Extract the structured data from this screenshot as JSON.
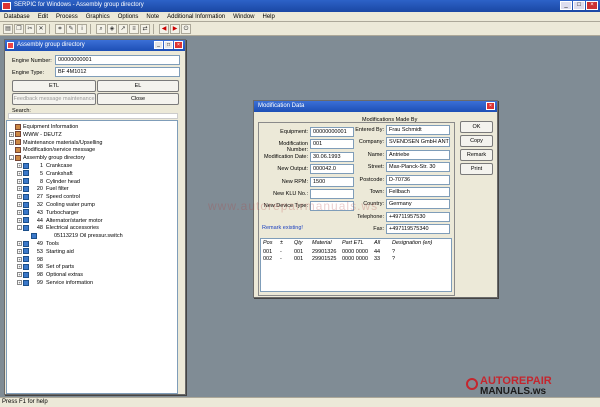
{
  "app": {
    "title": "SERPIC for Windows - Assembly group directory"
  },
  "menu": [
    "Database",
    "Edit",
    "Process",
    "Graphics",
    "Options",
    "Note",
    "Additional Information",
    "Window",
    "Help"
  ],
  "toolbar_icons": [
    "print-icon",
    "copy-icon",
    "scissors-icon",
    "close-icon",
    "cut-icon",
    "note-icon",
    "info-icon",
    "search-icon",
    "tag-icon",
    "arrow-icon",
    "list-icon",
    "swap-icon",
    "left-icon",
    "right-icon",
    "exit-icon"
  ],
  "status": "Press F1 for help",
  "assembly": {
    "title": "Assembly group directory",
    "engine_number_label": "Engine Number:",
    "engine_number": "00000000001",
    "engine_type_label": "Engine Type:",
    "engine_type": "BF 4M1012",
    "etl_button": "ETL",
    "el_button": "EL",
    "feedback_button": "Feedback message maintenance",
    "close_button": "Close",
    "search_label": "Search:",
    "tree": [
      {
        "num": "",
        "label": "Equipment Information",
        "level": 1,
        "exp": ""
      },
      {
        "num": "",
        "label": "WWW - DEUTZ",
        "level": 1,
        "exp": "+"
      },
      {
        "num": "",
        "label": "Maintenance materials/Upselling",
        "level": 1,
        "exp": "+"
      },
      {
        "num": "",
        "label": "Modification/service message",
        "level": 1,
        "exp": ""
      },
      {
        "num": "",
        "label": "Assembly group directory",
        "level": 1,
        "exp": "-"
      },
      {
        "num": "1",
        "label": "Crankcase",
        "level": 2,
        "exp": "+"
      },
      {
        "num": "5",
        "label": "Crankshaft",
        "level": 2,
        "exp": "+"
      },
      {
        "num": "8",
        "label": "Cylinder head",
        "level": 2,
        "exp": "+"
      },
      {
        "num": "20",
        "label": "Fuel filter",
        "level": 2,
        "exp": "+"
      },
      {
        "num": "27",
        "label": "Speed control",
        "level": 2,
        "exp": "+"
      },
      {
        "num": "32",
        "label": "Cooling water pump",
        "level": 2,
        "exp": "+"
      },
      {
        "num": "43",
        "label": "Turbocharger",
        "level": 2,
        "exp": "+"
      },
      {
        "num": "44",
        "label": "Alternator/starter motor",
        "level": 2,
        "exp": "+"
      },
      {
        "num": "48",
        "label": "Electrical accessories",
        "level": 2,
        "exp": "-"
      },
      {
        "num": "",
        "label": "05113219  Oil pressur.switch",
        "level": 3,
        "exp": ""
      },
      {
        "num": "49",
        "label": "Tools",
        "level": 2,
        "exp": "+"
      },
      {
        "num": "53",
        "label": "Starting aid",
        "level": 2,
        "exp": "+"
      },
      {
        "num": "98",
        "label": "",
        "level": 2,
        "exp": "+"
      },
      {
        "num": "98",
        "label": "Set of parts",
        "level": 2,
        "exp": "+"
      },
      {
        "num": "98",
        "label": "Optional extras",
        "level": 2,
        "exp": "+"
      },
      {
        "num": "99",
        "label": "Service information",
        "level": 2,
        "exp": "+"
      }
    ]
  },
  "modification": {
    "title": "Modification Data",
    "made_by": "Modifications Made By",
    "left_fields": [
      {
        "label": "Equipment:",
        "value": "00000000001"
      },
      {
        "label": "Modification Number:",
        "value": "001"
      },
      {
        "label": "Modification Date:",
        "value": "30.06.1993"
      },
      {
        "label": "New Output:",
        "value": "000042.0"
      },
      {
        "label": "New RPM:",
        "value": "1500"
      },
      {
        "label": "New KLU No.:",
        "value": ""
      },
      {
        "label": "New Device Type:",
        "value": ""
      }
    ],
    "right_fields": [
      {
        "label": "Entered By:",
        "value": "Frau Schmidt"
      },
      {
        "label": "Company:",
        "value": "SVENDSEN GmbH ANTRIE"
      },
      {
        "label": "Name:",
        "value": "Antriebe"
      },
      {
        "label": "Street:",
        "value": "Max-Planck-Str. 30"
      },
      {
        "label": "Postcode:",
        "value": "D-70736"
      },
      {
        "label": "Town:",
        "value": "Fellbach"
      },
      {
        "label": "Country:",
        "value": "Germany"
      },
      {
        "label": "Telephone:",
        "value": "+49711957530"
      },
      {
        "label": "Fax:",
        "value": "+497119575340"
      }
    ],
    "remark": "Remark existing!",
    "buttons": {
      "ok": "OK",
      "copy": "Copy",
      "remark": "Remark",
      "print": "Print"
    },
    "table_headers": [
      "Pos",
      "±",
      "Qty",
      "Material",
      "Part ETL",
      "All",
      "Designation (en)"
    ],
    "table_rows": [
      [
        "001",
        "-",
        "001",
        "29901326",
        "0000 0000",
        "44",
        "?"
      ],
      [
        "002",
        "-",
        "001",
        "29901525",
        "0000 0000",
        "33",
        "?"
      ]
    ]
  },
  "watermark": "www.autorepairmanuals.ws",
  "logo": {
    "top": "AUTOREPAIR",
    "bottom": "MANUALS.ws"
  }
}
